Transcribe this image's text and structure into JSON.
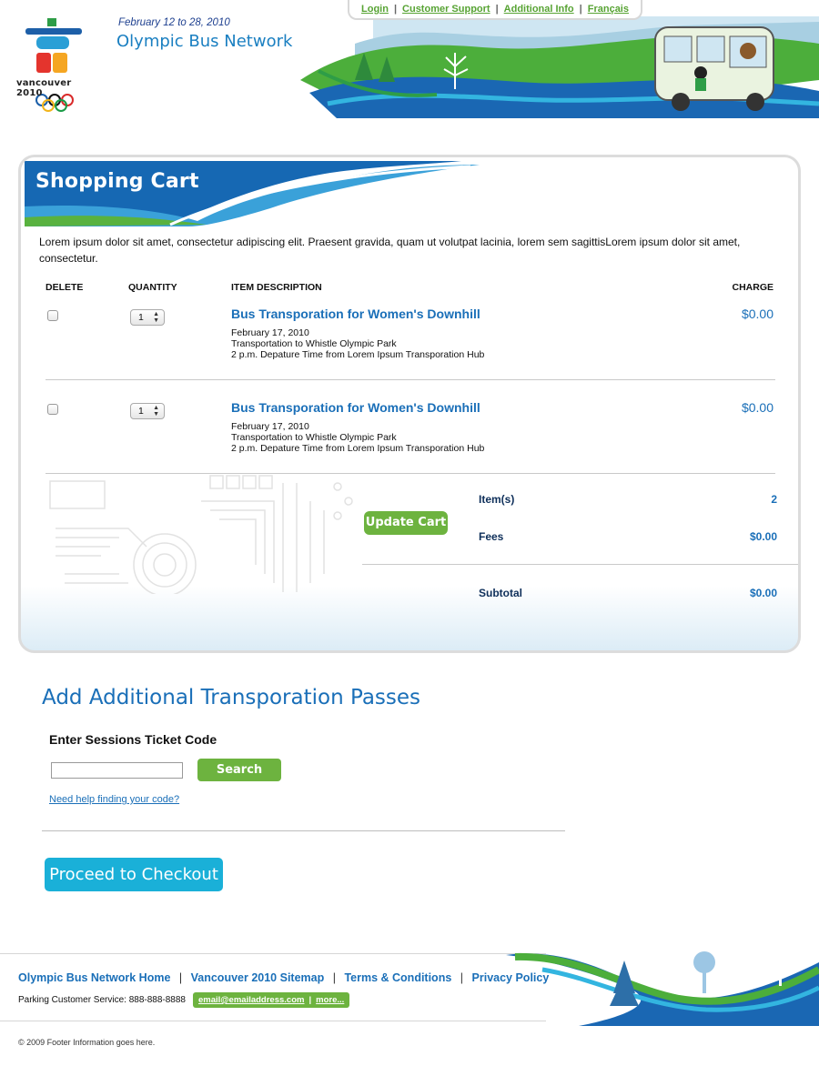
{
  "header": {
    "event_dates": "February 12 to 28, 2010",
    "site_title": "Olympic Bus Network",
    "logo_text": "vancouver 2010",
    "nav": [
      "Login",
      "Customer Support",
      "Additional Info",
      "Français"
    ]
  },
  "cart": {
    "title": "Shopping Cart",
    "intro": "Lorem ipsum dolor sit amet, consectetur adipiscing elit. Praesent gravida, quam ut volutpat lacinia, lorem sem sagittisLorem ipsum dolor sit amet, consectetur.",
    "columns": {
      "delete": "DELETE",
      "quantity": "QUANTITY",
      "description": "ITEM DESCRIPTION",
      "charge": "CHARGE"
    },
    "items": [
      {
        "quantity": "1",
        "title": "Bus Transporation for Women's Downhill",
        "date": "February 17, 2010",
        "route": "Transportation to Whistle Olympic Park",
        "departure": "2 p.m. Depature Time from Lorem Ipsum Transporation Hub",
        "charge": "$0.00"
      },
      {
        "quantity": "1",
        "title": "Bus Transporation for Women's Downhill",
        "date": "February 17, 2010",
        "route": "Transportation to Whistle Olympic Park",
        "departure": "2 p.m. Depature Time from Lorem Ipsum Transporation Hub",
        "charge": "$0.00"
      }
    ],
    "update_button": "Update Cart",
    "totals": {
      "items_label": "Item(s)",
      "items_value": "2",
      "fees_label": "Fees",
      "fees_value": "$0.00",
      "subtotal_label": "Subtotal",
      "subtotal_value": "$0.00"
    }
  },
  "additional": {
    "title": "Add Additional Transporation Passes",
    "code_label": "Enter Sessions Ticket Code",
    "code_value": "",
    "search_button": "Search",
    "help_link": "Need help finding your code?",
    "checkout_button": "Proceed to Checkout"
  },
  "footer": {
    "links": [
      "Olympic Bus Network Home",
      "Vancouver 2010 Sitemap",
      "Terms & Conditions",
      "Privacy Policy"
    ],
    "parking": "Parking Customer Service: 888-888-8888",
    "email": "email@emailaddress.com",
    "more": "more...",
    "copyright": "© 2009 Footer Information goes here."
  },
  "colors": {
    "accent_blue": "#1a6fb8",
    "accent_green": "#6db33f",
    "checkout_cyan": "#1ab0d8"
  }
}
